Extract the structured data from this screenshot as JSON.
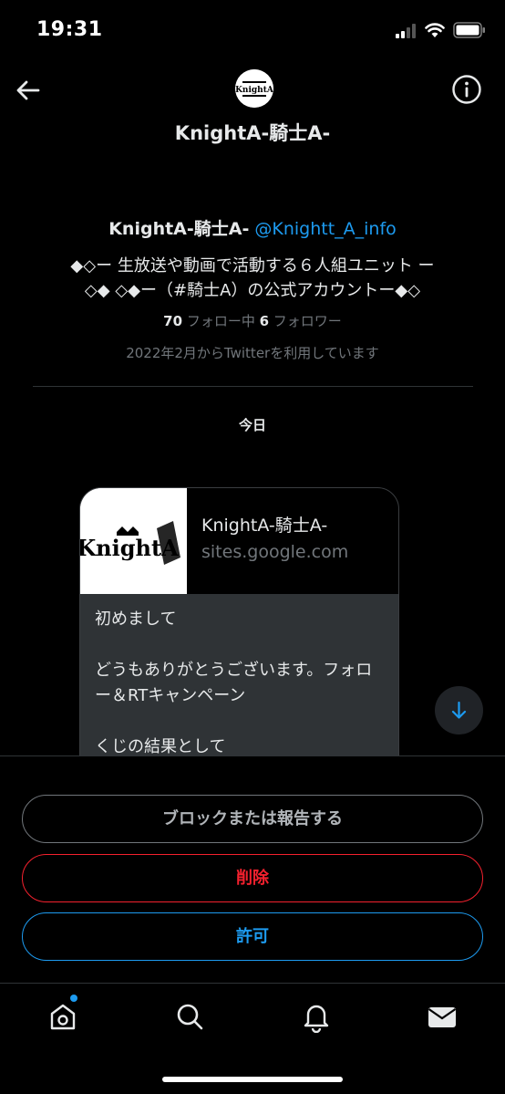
{
  "status_bar": {
    "time": "19:31"
  },
  "header": {
    "name": "KnightA-騎士A-",
    "avatar_text": "KnightA"
  },
  "profile": {
    "name": "KnightA-騎士A-",
    "handle": "@Knightt_A_info",
    "bio_line1": "◆◇ー 生放送や動画で活動する６人組ユニット ー",
    "bio_line2": "◇◆ ◇◆ー（#騎士A）の公式アカウントー◆◇",
    "following_count": "70",
    "following_label": " フォロー中 ",
    "followers_count": "6",
    "followers_label": " フォロワー",
    "joined": "2022年2月からTwitterを利用しています"
  },
  "conversation": {
    "date_label": "今日",
    "card": {
      "thumb_text": "KnightA",
      "title": "KnightA-騎士A-",
      "domain": "sites.google.com",
      "paragraph1": "初めまして",
      "paragraph2": "どうもありがとうございます。フォロー＆RTキャンペーン",
      "paragraph3": "くじの結果として"
    }
  },
  "actions": {
    "block_label": "ブロックまたは報告する",
    "delete_label": "削除",
    "allow_label": "許可"
  },
  "tab_bar": {
    "icons": [
      "home-icon",
      "search-icon",
      "notifications-icon",
      "messages-icon"
    ]
  },
  "colors": {
    "background": "#000000",
    "accent": "#1d9bf0",
    "danger": "#f4212e",
    "muted": "#71767b",
    "card_body": "#2f3336"
  }
}
